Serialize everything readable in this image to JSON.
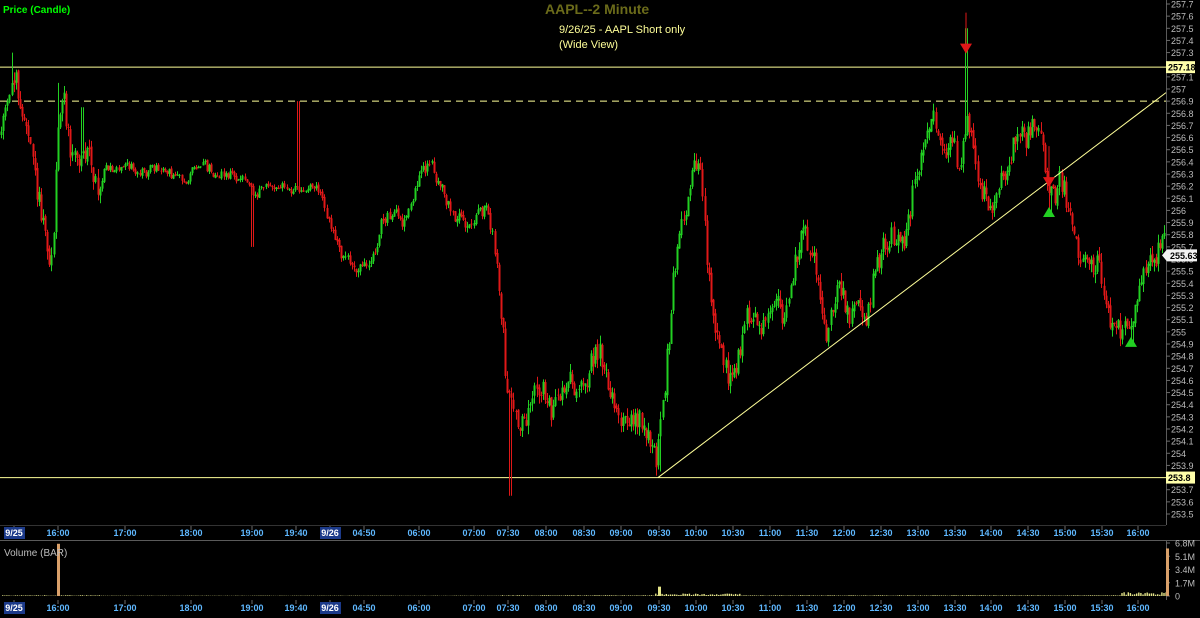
{
  "window": {
    "title": "AAPL--2 Minute",
    "panel_label": "Price (Candle)",
    "annotation_line1": "9/26/25 - AAPL  Short only",
    "annotation_line2": "(Wide View)",
    "volume_label": "Volume (BAR)"
  },
  "colors": {
    "background": "#000000",
    "up": "#22d022",
    "down": "#e01818",
    "axis_text": "#bdbdbd",
    "time_text": "#5fb8ff",
    "level_line": "#ffff99",
    "title": "#6b6b1a",
    "panel_label": "#00ff00",
    "price_tag_bg": "#ffffaa",
    "volume_bar": "#e6e68a"
  },
  "chart_data": [
    {
      "type": "candlestick",
      "title": "AAPL--2 Minute",
      "ylim": [
        253.5,
        257.8
      ],
      "y_ticks": [
        "257.7",
        "257.6",
        "257.5",
        "257.4",
        "257.3",
        "257.2",
        "257.1",
        "257",
        "256.9",
        "256.8",
        "256.7",
        "256.6",
        "256.5",
        "256.4",
        "256.3",
        "256.2",
        "256.1",
        "256",
        "255.9",
        "255.8",
        "255.7",
        "255.6",
        "255.5",
        "255.4",
        "255.3",
        "255.2",
        "255.1",
        "255",
        "254.9",
        "254.8",
        "254.7",
        "254.6",
        "254.5",
        "254.4",
        "254.3",
        "254.2",
        "254.1",
        "254",
        "253.9",
        "253.8",
        "253.7",
        "253.6",
        "253.5"
      ],
      "x_ticks": [
        "9/25",
        "16:00",
        "17:00",
        "18:00",
        "19:00",
        "19:40",
        "9/26",
        "04:50",
        "06:00",
        "07:00",
        "07:30",
        "08:00",
        "08:30",
        "09:00",
        "09:30",
        "10:00",
        "10:30",
        "11:00",
        "11:30",
        "12:00",
        "12:30",
        "13:00",
        "13:30",
        "14:00",
        "14:30",
        "15:00",
        "15:30",
        "16:00"
      ],
      "date_marker_ticks": [
        "9/25",
        "9/26"
      ],
      "path": [
        [
          0,
          256.6
        ],
        [
          8,
          257.0
        ],
        [
          16,
          257.05
        ],
        [
          22,
          256.8
        ],
        [
          30,
          256.5
        ],
        [
          40,
          256.0
        ],
        [
          48,
          255.6
        ],
        [
          52,
          255.55
        ],
        [
          58,
          256.8
        ],
        [
          64,
          256.9
        ],
        [
          70,
          256.5
        ],
        [
          80,
          256.4
        ],
        [
          90,
          256.5
        ],
        [
          98,
          256.1
        ],
        [
          106,
          256.4
        ],
        [
          112,
          256.3
        ],
        [
          125,
          256.4
        ],
        [
          140,
          256.3
        ],
        [
          155,
          256.35
        ],
        [
          170,
          256.3
        ],
        [
          185,
          256.25
        ],
        [
          200,
          256.4
        ],
        [
          215,
          256.3
        ],
        [
          230,
          256.3
        ],
        [
          245,
          256.25
        ],
        [
          255,
          256.1
        ],
        [
          265,
          256.2
        ],
        [
          280,
          256.2
        ],
        [
          300,
          256.15
        ],
        [
          315,
          256.2
        ],
        [
          322,
          256.1
        ],
        [
          332,
          255.8
        ],
        [
          345,
          255.6
        ],
        [
          360,
          255.5
        ],
        [
          372,
          255.6
        ],
        [
          382,
          255.9
        ],
        [
          392,
          256.0
        ],
        [
          402,
          255.9
        ],
        [
          412,
          256.1
        ],
        [
          420,
          256.3
        ],
        [
          430,
          256.4
        ],
        [
          440,
          256.2
        ],
        [
          450,
          256.0
        ],
        [
          462,
          255.9
        ],
        [
          475,
          255.95
        ],
        [
          488,
          256.0
        ],
        [
          496,
          255.6
        ],
        [
          502,
          255.1
        ],
        [
          506,
          254.6
        ],
        [
          512,
          254.4
        ],
        [
          520,
          254.2
        ],
        [
          528,
          254.3
        ],
        [
          536,
          254.6
        ],
        [
          544,
          254.5
        ],
        [
          552,
          254.3
        ],
        [
          560,
          254.5
        ],
        [
          570,
          254.6
        ],
        [
          582,
          254.5
        ],
        [
          590,
          254.7
        ],
        [
          596,
          254.9
        ],
        [
          604,
          254.7
        ],
        [
          612,
          254.5
        ],
        [
          620,
          254.3
        ],
        [
          628,
          254.2
        ],
        [
          636,
          254.3
        ],
        [
          644,
          254.2
        ],
        [
          650,
          254.1
        ],
        [
          656,
          253.95
        ],
        [
          662,
          254.3
        ],
        [
          668,
          254.9
        ],
        [
          674,
          255.5
        ],
        [
          680,
          255.9
        ],
        [
          688,
          256.1
        ],
        [
          696,
          256.4
        ],
        [
          702,
          256.2
        ],
        [
          706,
          255.6
        ],
        [
          712,
          255.2
        ],
        [
          718,
          254.9
        ],
        [
          724,
          254.7
        ],
        [
          730,
          254.6
        ],
        [
          738,
          254.8
        ],
        [
          746,
          255.1
        ],
        [
          752,
          255.2
        ],
        [
          760,
          255.0
        ],
        [
          768,
          255.2
        ],
        [
          776,
          255.3
        ],
        [
          784,
          255.1
        ],
        [
          790,
          255.3
        ],
        [
          798,
          255.7
        ],
        [
          806,
          255.8
        ],
        [
          814,
          255.6
        ],
        [
          820,
          255.3
        ],
        [
          826,
          255.0
        ],
        [
          832,
          255.2
        ],
        [
          840,
          255.4
        ],
        [
          848,
          255.1
        ],
        [
          856,
          255.2
        ],
        [
          864,
          255.05
        ],
        [
          870,
          255.3
        ],
        [
          878,
          255.6
        ],
        [
          886,
          255.75
        ],
        [
          894,
          255.8
        ],
        [
          902,
          255.7
        ],
        [
          910,
          256.0
        ],
        [
          916,
          256.3
        ],
        [
          922,
          256.45
        ],
        [
          928,
          256.6
        ],
        [
          934,
          256.8
        ],
        [
          940,
          256.6
        ],
        [
          946,
          256.5
        ],
        [
          952,
          256.6
        ],
        [
          958,
          256.4
        ],
        [
          964,
          256.5
        ],
        [
          968,
          256.75
        ],
        [
          972,
          256.6
        ],
        [
          978,
          256.3
        ],
        [
          984,
          256.1
        ],
        [
          990,
          256.0
        ],
        [
          998,
          256.2
        ],
        [
          1006,
          256.3
        ],
        [
          1012,
          256.5
        ],
        [
          1018,
          256.7
        ],
        [
          1026,
          256.6
        ],
        [
          1034,
          256.7
        ],
        [
          1042,
          256.5
        ],
        [
          1048,
          256.2
        ],
        [
          1054,
          256.1
        ],
        [
          1060,
          256.25
        ],
        [
          1066,
          256.1
        ],
        [
          1074,
          255.8
        ],
        [
          1082,
          255.6
        ],
        [
          1090,
          255.5
        ],
        [
          1098,
          255.6
        ],
        [
          1104,
          255.3
        ],
        [
          1110,
          255.05
        ],
        [
          1118,
          255.0
        ],
        [
          1124,
          255.1
        ],
        [
          1130,
          255.0
        ],
        [
          1136,
          255.3
        ],
        [
          1142,
          255.5
        ],
        [
          1150,
          255.55
        ],
        [
          1158,
          255.65
        ],
        [
          1166,
          255.75
        ]
      ],
      "spikes": [
        {
          "x": 12,
          "high": 257.3
        },
        {
          "x": 58,
          "high": 257.05
        },
        {
          "x": 82,
          "high": 256.85
        },
        {
          "x": 252,
          "low": 255.7
        },
        {
          "x": 298,
          "high": 256.9
        },
        {
          "x": 510,
          "low": 253.65
        },
        {
          "x": 660,
          "low": 253.85
        },
        {
          "x": 966,
          "high": 257.5
        },
        {
          "x": 1050,
          "low": 255.95
        },
        {
          "x": 1132,
          "low": 254.9
        }
      ],
      "horizontal_levels": [
        {
          "value": 257.18,
          "style": "solid",
          "tag": "257.18"
        },
        {
          "value": 256.9,
          "style": "dashed"
        },
        {
          "value": 253.8,
          "style": "solid",
          "tag": "253.8"
        }
      ],
      "trendline": {
        "from_x": 658,
        "from_y": 253.8,
        "to_x": 1166,
        "to_y": 256.97
      },
      "arrows": [
        {
          "x": 966,
          "price": 257.3,
          "dir": "down",
          "color": "#e01818"
        },
        {
          "x": 1049,
          "price": 256.2,
          "dir": "down",
          "color": "#e01818"
        },
        {
          "x": 1049,
          "price": 256.02,
          "dir": "up",
          "color": "#22d022"
        },
        {
          "x": 1131,
          "price": 254.95,
          "dir": "up",
          "color": "#22d022"
        }
      ],
      "last_price": "255.63"
    },
    {
      "type": "bar",
      "title": "Volume (BAR)",
      "y_ticks": [
        "6.8M",
        "5.1M",
        "3.4M",
        "1.7M",
        "0"
      ],
      "ylim": [
        0,
        6.8
      ],
      "spikes": [
        {
          "x": 58,
          "value": 6.7
        },
        {
          "x": 659,
          "value": 1.2
        },
        {
          "x": 1167,
          "value": 6.1
        }
      ]
    }
  ]
}
